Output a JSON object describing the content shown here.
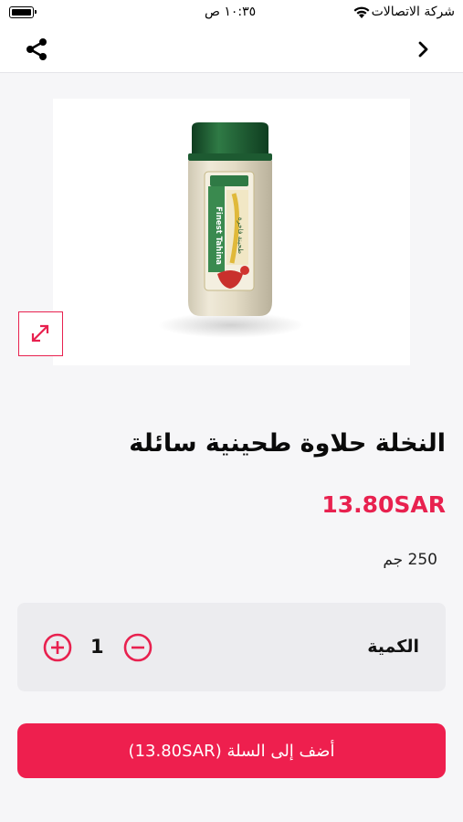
{
  "status_bar": {
    "carrier": "شركة الاتصالات",
    "time": "١٠:٣٥ ص"
  },
  "nav": {
    "back_icon": "chevron-right-icon",
    "share_icon": "share-icon"
  },
  "product": {
    "title": "النخلة حلاوة طحينية سائلة",
    "price": "13.80SAR",
    "weight": "250 جم",
    "image_jar_label_en": "Finest Tahina",
    "image_jar_label_ar": "طحينة فاخرة"
  },
  "quantity": {
    "label": "الكمية",
    "value": "1"
  },
  "cart": {
    "add_label": "أضف إلى السلة (13.80SAR)"
  },
  "colors": {
    "accent": "#ee1f4e",
    "price": "#e8214f",
    "jar_cap": "#2f7a45",
    "background": "#f6f6f8"
  }
}
